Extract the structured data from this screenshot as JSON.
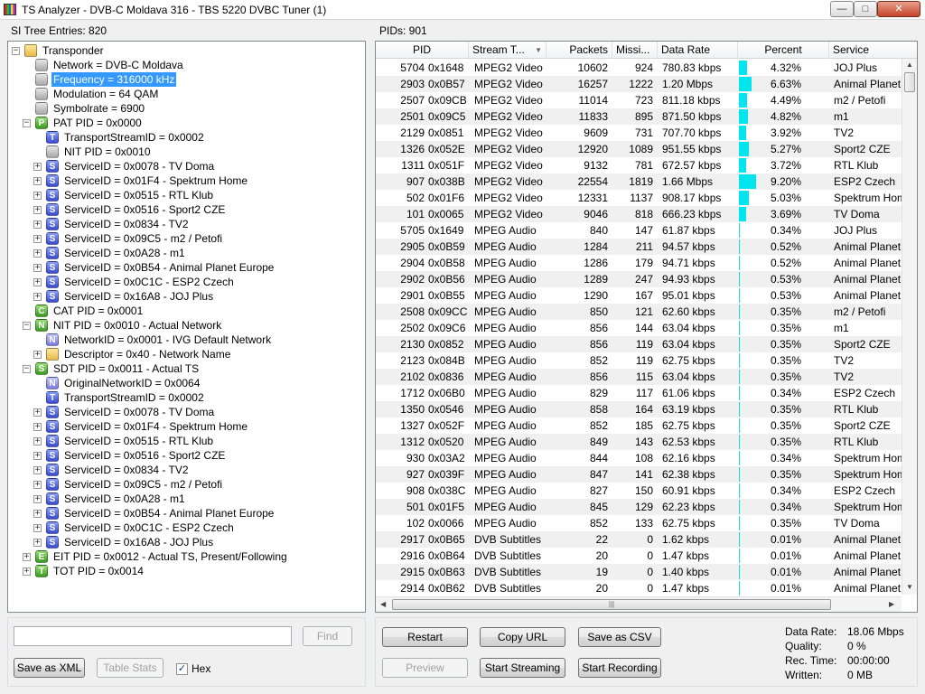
{
  "window": {
    "title": "TS Analyzer - DVB-C Moldava 316 - TBS 5220 DVBC Tuner (1)",
    "minimize": "—",
    "maximize": "□",
    "close": "✕"
  },
  "left_panel": {
    "label": "SI Tree Entries: 820",
    "tree": [
      {
        "text": "Transponder",
        "icon": "folder",
        "level": 0,
        "expander": "-"
      },
      {
        "text": "Network = DVB-C Moldava",
        "icon": "gray",
        "level": 1
      },
      {
        "text": "Frequency = 316000 kHz",
        "icon": "gray",
        "level": 1,
        "selected": true
      },
      {
        "text": "Modulation = 64 QAM",
        "icon": "gray",
        "level": 1
      },
      {
        "text": "Symbolrate = 6900",
        "icon": "gray",
        "level": 1
      },
      {
        "text": "PAT PID = 0x0000",
        "icon": "P",
        "level": 1,
        "expander": "-"
      },
      {
        "text": "TransportStreamID = 0x0002",
        "icon": "T",
        "level": 2
      },
      {
        "text": "NIT PID = 0x0010",
        "icon": "gray",
        "level": 2
      },
      {
        "text": "ServiceID = 0x0078 - TV Doma",
        "icon": "S",
        "level": 2,
        "expander": "+"
      },
      {
        "text": "ServiceID = 0x01F4 - Spektrum Home",
        "icon": "S",
        "level": 2,
        "expander": "+"
      },
      {
        "text": "ServiceID = 0x0515 - RTL Klub",
        "icon": "S",
        "level": 2,
        "expander": "+"
      },
      {
        "text": "ServiceID = 0x0516 - Sport2 CZE",
        "icon": "S",
        "level": 2,
        "expander": "+"
      },
      {
        "text": "ServiceID = 0x0834 - TV2",
        "icon": "S",
        "level": 2,
        "expander": "+"
      },
      {
        "text": "ServiceID = 0x09C5 - m2 / Petofi",
        "icon": "S",
        "level": 2,
        "expander": "+"
      },
      {
        "text": "ServiceID = 0x0A28 - m1",
        "icon": "S",
        "level": 2,
        "expander": "+"
      },
      {
        "text": "ServiceID = 0x0B54 - Animal Planet Europe",
        "icon": "S",
        "level": 2,
        "expander": "+"
      },
      {
        "text": "ServiceID = 0x0C1C - ESP2 Czech",
        "icon": "S",
        "level": 2,
        "expander": "+"
      },
      {
        "text": "ServiceID = 0x16A8 - JOJ Plus",
        "icon": "S",
        "level": 2,
        "expander": "+"
      },
      {
        "text": "CAT PID = 0x0001",
        "icon": "C",
        "level": 1
      },
      {
        "text": "NIT PID = 0x0010 - Actual Network",
        "icon": "N",
        "level": 1,
        "expander": "-"
      },
      {
        "text": "NetworkID = 0x0001 - IVG Default Network",
        "icon": "Nb",
        "level": 2
      },
      {
        "text": "Descriptor = 0x40 - Network Name",
        "icon": "folder",
        "level": 2,
        "expander": "+"
      },
      {
        "text": "SDT PID = 0x0011 - Actual TS",
        "icon": "S2",
        "level": 1,
        "expander": "-"
      },
      {
        "text": "OriginalNetworkID = 0x0064",
        "icon": "Nb",
        "level": 2
      },
      {
        "text": "TransportStreamID = 0x0002",
        "icon": "T",
        "level": 2
      },
      {
        "text": "ServiceID = 0x0078 - TV Doma",
        "icon": "S",
        "level": 2,
        "expander": "+"
      },
      {
        "text": "ServiceID = 0x01F4 - Spektrum Home",
        "icon": "S",
        "level": 2,
        "expander": "+"
      },
      {
        "text": "ServiceID = 0x0515 - RTL Klub",
        "icon": "S",
        "level": 2,
        "expander": "+"
      },
      {
        "text": "ServiceID = 0x0516 - Sport2 CZE",
        "icon": "S",
        "level": 2,
        "expander": "+"
      },
      {
        "text": "ServiceID = 0x0834 - TV2",
        "icon": "S",
        "level": 2,
        "expander": "+"
      },
      {
        "text": "ServiceID = 0x09C5 - m2 / Petofi",
        "icon": "S",
        "level": 2,
        "expander": "+"
      },
      {
        "text": "ServiceID = 0x0A28 - m1",
        "icon": "S",
        "level": 2,
        "expander": "+"
      },
      {
        "text": "ServiceID = 0x0B54 - Animal Planet Europe",
        "icon": "S",
        "level": 2,
        "expander": "+"
      },
      {
        "text": "ServiceID = 0x0C1C - ESP2 Czech",
        "icon": "S",
        "level": 2,
        "expander": "+"
      },
      {
        "text": "ServiceID = 0x16A8 - JOJ Plus",
        "icon": "S",
        "level": 2,
        "expander": "+"
      },
      {
        "text": "EIT PID = 0x0012 - Actual TS, Present/Following",
        "icon": "E",
        "level": 1,
        "expander": "+"
      },
      {
        "text": "TOT PID = 0x0014",
        "icon": "Tg",
        "level": 1,
        "expander": "+"
      }
    ],
    "search_value": "",
    "find_label": "Find",
    "save_xml_label": "Save as XML",
    "table_stats_label": "Table Stats",
    "hex_label": "Hex",
    "hex_checked": "✓"
  },
  "right_panel": {
    "label": "PIDs: 901",
    "columns": [
      "PID",
      "Stream T...",
      "Packets",
      "Missi...",
      "Data Rate",
      "Percent",
      "Service"
    ],
    "rows": [
      [
        "5704",
        "0x1648",
        "MPEG2 Video",
        "10602",
        "924",
        "780.83 kbps",
        "4.32%",
        "JOJ Plus",
        4.32
      ],
      [
        "2903",
        "0x0B57",
        "MPEG2 Video",
        "16257",
        "1222",
        "1.20 Mbps",
        "6.63%",
        "Animal Planet",
        6.63
      ],
      [
        "2507",
        "0x09CB",
        "MPEG2 Video",
        "11014",
        "723",
        "811.18 kbps",
        "4.49%",
        "m2 / Petofi",
        4.49
      ],
      [
        "2501",
        "0x09C5",
        "MPEG2 Video",
        "11833",
        "895",
        "871.50 kbps",
        "4.82%",
        "m1",
        4.82
      ],
      [
        "2129",
        "0x0851",
        "MPEG2 Video",
        "9609",
        "731",
        "707.70 kbps",
        "3.92%",
        "TV2",
        3.92
      ],
      [
        "1326",
        "0x052E",
        "MPEG2 Video",
        "12920",
        "1089",
        "951.55 kbps",
        "5.27%",
        "Sport2 CZE",
        5.27
      ],
      [
        "1311",
        "0x051F",
        "MPEG2 Video",
        "9132",
        "781",
        "672.57 kbps",
        "3.72%",
        "RTL Klub",
        3.72
      ],
      [
        "907",
        "0x038B",
        "MPEG2 Video",
        "22554",
        "1819",
        "1.66 Mbps",
        "9.20%",
        "ESP2 Czech",
        9.2
      ],
      [
        "502",
        "0x01F6",
        "MPEG2 Video",
        "12331",
        "1137",
        "908.17 kbps",
        "5.03%",
        "Spektrum Hom",
        5.03
      ],
      [
        "101",
        "0x0065",
        "MPEG2 Video",
        "9046",
        "818",
        "666.23 kbps",
        "3.69%",
        "TV Doma",
        3.69
      ],
      [
        "5705",
        "0x1649",
        "MPEG Audio",
        "840",
        "147",
        "61.87 kbps",
        "0.34%",
        "JOJ Plus",
        0.34
      ],
      [
        "2905",
        "0x0B59",
        "MPEG Audio",
        "1284",
        "211",
        "94.57 kbps",
        "0.52%",
        "Animal Planet",
        0.52
      ],
      [
        "2904",
        "0x0B58",
        "MPEG Audio",
        "1286",
        "179",
        "94.71 kbps",
        "0.52%",
        "Animal Planet",
        0.52
      ],
      [
        "2902",
        "0x0B56",
        "MPEG Audio",
        "1289",
        "247",
        "94.93 kbps",
        "0.53%",
        "Animal Planet",
        0.53
      ],
      [
        "2901",
        "0x0B55",
        "MPEG Audio",
        "1290",
        "167",
        "95.01 kbps",
        "0.53%",
        "Animal Planet",
        0.53
      ],
      [
        "2508",
        "0x09CC",
        "MPEG Audio",
        "850",
        "121",
        "62.60 kbps",
        "0.35%",
        "m2 / Petofi",
        0.35
      ],
      [
        "2502",
        "0x09C6",
        "MPEG Audio",
        "856",
        "144",
        "63.04 kbps",
        "0.35%",
        "m1",
        0.35
      ],
      [
        "2130",
        "0x0852",
        "MPEG Audio",
        "856",
        "119",
        "63.04 kbps",
        "0.35%",
        "Sport2 CZE",
        0.35
      ],
      [
        "2123",
        "0x084B",
        "MPEG Audio",
        "852",
        "119",
        "62.75 kbps",
        "0.35%",
        "TV2",
        0.35
      ],
      [
        "2102",
        "0x0836",
        "MPEG Audio",
        "856",
        "115",
        "63.04 kbps",
        "0.35%",
        "TV2",
        0.35
      ],
      [
        "1712",
        "0x06B0",
        "MPEG Audio",
        "829",
        "117",
        "61.06 kbps",
        "0.34%",
        "ESP2 Czech",
        0.34
      ],
      [
        "1350",
        "0x0546",
        "MPEG Audio",
        "858",
        "164",
        "63.19 kbps",
        "0.35%",
        "RTL Klub",
        0.35
      ],
      [
        "1327",
        "0x052F",
        "MPEG Audio",
        "852",
        "185",
        "62.75 kbps",
        "0.35%",
        "Sport2 CZE",
        0.35
      ],
      [
        "1312",
        "0x0520",
        "MPEG Audio",
        "849",
        "143",
        "62.53 kbps",
        "0.35%",
        "RTL Klub",
        0.35
      ],
      [
        "930",
        "0x03A2",
        "MPEG Audio",
        "844",
        "108",
        "62.16 kbps",
        "0.34%",
        "Spektrum Hom",
        0.34
      ],
      [
        "927",
        "0x039F",
        "MPEG Audio",
        "847",
        "141",
        "62.38 kbps",
        "0.35%",
        "Spektrum Hom",
        0.35
      ],
      [
        "908",
        "0x038C",
        "MPEG Audio",
        "827",
        "150",
        "60.91 kbps",
        "0.34%",
        "ESP2 Czech",
        0.34
      ],
      [
        "501",
        "0x01F5",
        "MPEG Audio",
        "845",
        "129",
        "62.23 kbps",
        "0.34%",
        "Spektrum Hom",
        0.34
      ],
      [
        "102",
        "0x0066",
        "MPEG Audio",
        "852",
        "133",
        "62.75 kbps",
        "0.35%",
        "TV Doma",
        0.35
      ],
      [
        "2917",
        "0x0B65",
        "DVB Subtitles",
        "22",
        "0",
        "1.62 kbps",
        "0.01%",
        "Animal Planet",
        0.01
      ],
      [
        "2916",
        "0x0B64",
        "DVB Subtitles",
        "20",
        "0",
        "1.47 kbps",
        "0.01%",
        "Animal Planet",
        0.01
      ],
      [
        "2915",
        "0x0B63",
        "DVB Subtitles",
        "19",
        "0",
        "1.40 kbps",
        "0.01%",
        "Animal Planet",
        0.01
      ],
      [
        "2914",
        "0x0B62",
        "DVB Subtitles",
        "20",
        "0",
        "1.47 kbps",
        "0.01%",
        "Animal Planet",
        0.01
      ]
    ],
    "bar_color": "#00e5ee",
    "hscroll_grip": "|||",
    "restart_label": "Restart",
    "copy_url_label": "Copy URL",
    "save_csv_label": "Save as CSV",
    "preview_label": "Preview",
    "start_streaming_label": "Start Streaming",
    "start_recording_label": "Start Recording",
    "stats": {
      "data_rate_label": "Data Rate:",
      "data_rate": "18.06 Mbps",
      "quality_label": "Quality:",
      "quality": "0 %",
      "rec_time_label": "Rec. Time:",
      "rec_time": "00:00:00",
      "written_label": "Written:",
      "written": "0 MB"
    }
  }
}
